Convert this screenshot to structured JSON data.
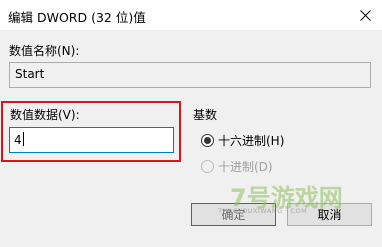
{
  "window": {
    "title": "编辑 DWORD (32 位)值",
    "close_icon": "close-icon"
  },
  "value_name": {
    "label": "数值名称(N):",
    "value": "Start"
  },
  "value_data": {
    "label": "数值数据(V):",
    "value": "4"
  },
  "base": {
    "label": "基数",
    "options": [
      {
        "label": "十六进制(H)",
        "selected": true,
        "enabled": true
      },
      {
        "label": "十进制(D)",
        "selected": false,
        "enabled": false
      }
    ]
  },
  "buttons": {
    "ok": "确定",
    "cancel": "取消"
  },
  "watermark": {
    "main": "7号游戏网",
    "sub": "THAOYOUXIWANG · COM"
  },
  "colors": {
    "highlight": "#d9151b",
    "focus_border": "#0078d7",
    "watermark": "#8fbf5a"
  }
}
